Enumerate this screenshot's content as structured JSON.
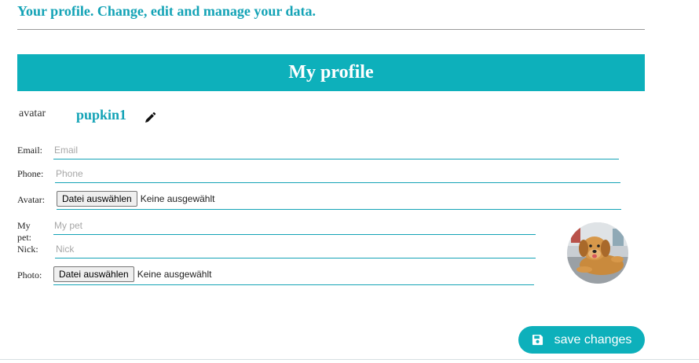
{
  "page": {
    "heading": "Your profile. Change, edit and manage your data."
  },
  "profile": {
    "title": "My profile",
    "avatar_alt": "avatar",
    "username": "pupkin1"
  },
  "form": {
    "email": {
      "label": "Email:",
      "placeholder": "Email"
    },
    "phone": {
      "label": "Phone:",
      "placeholder": "Phone"
    },
    "avatar": {
      "label": "Avatar:",
      "button": "Datei auswählen",
      "status": "Keine ausgewählt"
    },
    "pet": {
      "label": "My pet:",
      "placeholder": "My pet"
    },
    "nick": {
      "label": "Nick:",
      "placeholder": "Nick"
    },
    "photo": {
      "label": "Photo:",
      "button": "Datei auswählen",
      "status": "Keine ausgewählt"
    }
  },
  "actions": {
    "save_label": "save changes"
  },
  "colors": {
    "accent": "#0db0bb",
    "heading_text": "#14a3b6"
  },
  "icons": {
    "edit": "pencil-icon",
    "save": "floppy-disk-icon",
    "broken_image": "broken-image-icon"
  }
}
